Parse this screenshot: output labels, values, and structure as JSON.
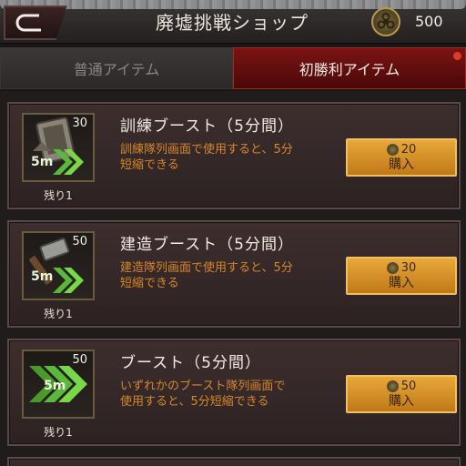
{
  "header": {
    "back_label": "",
    "title": "廃墟挑戦ショップ",
    "currency_amount": "500",
    "currency_icon": "biohazard-coin-icon"
  },
  "tabs": [
    {
      "label": "普通アイテム",
      "active": false
    },
    {
      "label": "初勝利アイテム",
      "active": true
    }
  ],
  "items": [
    {
      "name": "訓練ブースト（5分間）",
      "desc_line1": "訓練隊列画面で使用すると、5分",
      "desc_line2": "短縮できる",
      "count": "30",
      "badge": "5m",
      "remaining": "残り1",
      "price": "20",
      "buy_label": "購入",
      "icon": "training-boost-icon"
    },
    {
      "name": "建造ブースト（5分間）",
      "desc_line1": "建造隊列画面で使用すると、5分",
      "desc_line2": "短縮できる",
      "count": "50",
      "badge": "5m",
      "remaining": "残り1",
      "price": "30",
      "buy_label": "購入",
      "icon": "build-boost-icon"
    },
    {
      "name": "ブースト（5分間）",
      "desc_line1": "いずれかのブースト隊列画面で",
      "desc_line2": "使用すると、5分短縮できる",
      "count": "50",
      "badge": "5m",
      "remaining": "残り1",
      "price": "50",
      "buy_label": "購入",
      "icon": "general-boost-icon"
    }
  ],
  "colors": {
    "accent_red": "#7a1414",
    "desc_orange": "#d8862a",
    "buy_gold": "#e8a83a"
  }
}
